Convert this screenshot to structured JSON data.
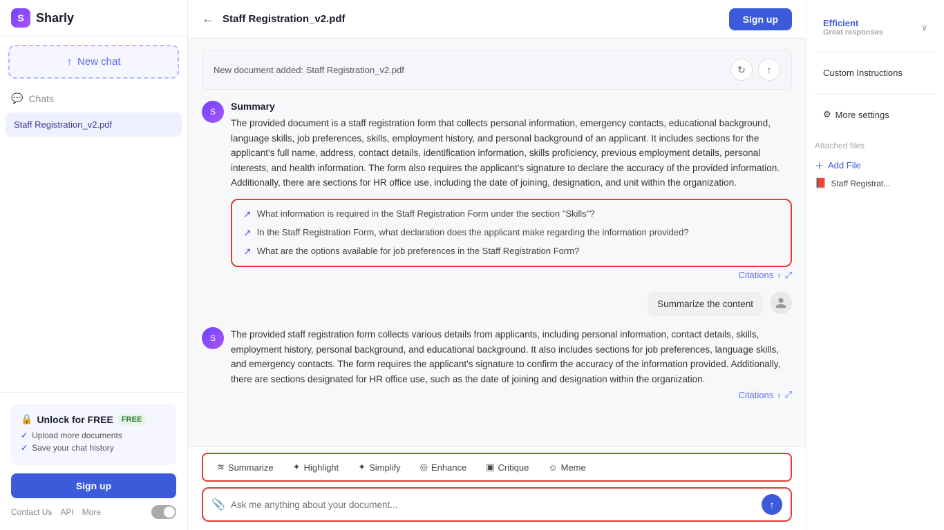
{
  "app": {
    "name": "Sharly"
  },
  "sidebar": {
    "new_chat_label": "New chat",
    "chats_label": "Chats",
    "chat_items": [
      {
        "label": "Staff Registration_v2.pdf",
        "active": true
      }
    ],
    "unlock_title": "Unlock for FREE",
    "free_badge": "FREE",
    "unlock_items": [
      "Upload more documents",
      "Save your chat history"
    ],
    "sign_up_label": "Sign up",
    "footer_links": [
      "Contact Us",
      "API",
      "More"
    ]
  },
  "topbar": {
    "doc_title": "Staff Registration_v2.pdf",
    "sign_up_label": "Sign up"
  },
  "chat": {
    "doc_added_text": "New document added: Staff Registration_v2.pdf",
    "messages": [
      {
        "type": "assistant",
        "summary_label": "Summary",
        "text": "The provided document is a staff registration form that collects personal information, emergency contacts, educational background, language skills, job preferences, skills, employment history, and personal background of an applicant. It includes sections for the applicant's full name, address, contact details, identification information, skills proficiency, previous employment details, personal interests, and health information. The form also requires the applicant's signature to declare the accuracy of the provided information. Additionally, there are sections for HR office use, including the date of joining, designation, and unit within the organization.",
        "has_suggestions": true,
        "suggestions": [
          "What information is required in the Staff Registration Form under the section \"Skills\"?",
          "In the Staff Registration Form, what declaration does the applicant make regarding the information provided?",
          "What are the options available for job preferences in the Staff Registration Form?"
        ],
        "citations_label": "Citations"
      },
      {
        "type": "user",
        "text": "Summarize the content"
      },
      {
        "type": "assistant",
        "text": "The provided staff registration form collects various details from applicants, including personal information, contact details, skills, employment history, personal background, and educational background. It also includes sections for job preferences, language skills, and emergency contacts. The form requires the applicant's signature to confirm the accuracy of the information provided. Additionally, there are sections designated for HR office use, such as the date of joining and designation within the organization.",
        "citations_label": "Citations"
      }
    ]
  },
  "toolbar": {
    "actions": [
      {
        "label": "Summarize",
        "icon": "≋"
      },
      {
        "label": "Highlight",
        "icon": "✦"
      },
      {
        "label": "Simplify",
        "icon": "✦"
      },
      {
        "label": "Enhance",
        "icon": "◎"
      },
      {
        "label": "Critique",
        "icon": "▣"
      },
      {
        "label": "Meme",
        "icon": "☺"
      }
    ],
    "input_placeholder": "Ask me anything about your document..."
  },
  "right_panel": {
    "items": [
      {
        "label": "Efficient",
        "sublabel": "Great responses",
        "has_chevron": true,
        "primary": true
      },
      {
        "label": "Custom Instructions",
        "has_chevron": false
      },
      {
        "label": "More settings",
        "has_chevron": false,
        "has_gear": true
      }
    ],
    "attached_label": "Attached files",
    "add_file_label": "Add File",
    "attached_files": [
      {
        "name": "Staff Registrat..."
      }
    ]
  }
}
